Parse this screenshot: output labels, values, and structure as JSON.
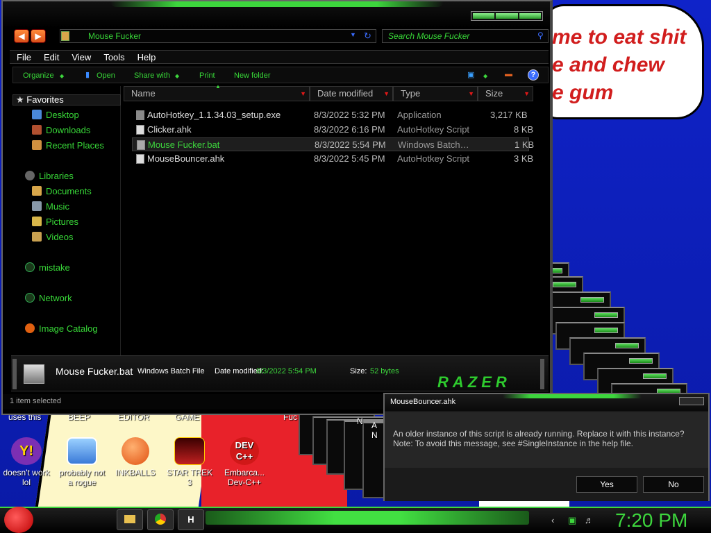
{
  "explorer": {
    "address": "Mouse Fucker",
    "search_placeholder": "Search Mouse Fucker",
    "menu": [
      "File",
      "Edit",
      "View",
      "Tools",
      "Help"
    ],
    "commands": [
      "Organize",
      "Open",
      "Share with",
      "Print",
      "New folder"
    ],
    "sidebar": {
      "favorites": "Favorites",
      "fav_items": [
        "Desktop",
        "Downloads",
        "Recent Places"
      ],
      "libraries": "Libraries",
      "lib_items": [
        "Documents",
        "Music",
        "Pictures",
        "Videos"
      ],
      "mistake": "mistake",
      "network": "Network",
      "catalog": "Image Catalog"
    },
    "columns": [
      "Name",
      "Date modified",
      "Type",
      "Size"
    ],
    "files": [
      {
        "name": "AutoHotkey_1.1.34.03_setup.exe",
        "date": "8/3/2022 5:32 PM",
        "type": "Application",
        "size": "3,217 KB"
      },
      {
        "name": "Clicker.ahk",
        "date": "8/3/2022 6:16 PM",
        "type": "AutoHotkey Script",
        "size": "8 KB"
      },
      {
        "name": "Mouse Fucker.bat",
        "date": "8/3/2022 5:54 PM",
        "type": "Windows Batch…",
        "size": "1 KB"
      },
      {
        "name": "MouseBouncer.ahk",
        "date": "8/3/2022 5:45 PM",
        "type": "AutoHotkey Script",
        "size": "3 KB"
      }
    ],
    "details": {
      "filename": "Mouse Fucker.bat",
      "filetype": "Windows Batch File",
      "date_label": "Date modified:",
      "date": "8/3/2022 5:54 PM",
      "size_label": "Size:",
      "size": "52 bytes",
      "brand": "RAZER"
    },
    "status": "1 item selected"
  },
  "dialog": {
    "title": "MouseBouncer.ahk",
    "line1": "An older instance of this script is already running.  Replace it with this instance?",
    "line2": "Note: To avoid this message, see #SingleInstance in the help file.",
    "yes": "Yes",
    "no": "No"
  },
  "wallpaper_bubble": [
    "me to eat shit",
    "e and chew",
    "e gum"
  ],
  "desktop": {
    "top_labels": [
      "uses this",
      "BEEP",
      "EDITOR",
      "GAME",
      "Fuc",
      "N",
      "A",
      "N"
    ],
    "icons": [
      {
        "label": "doesn't work lol"
      },
      {
        "label": "probably not a rogue"
      },
      {
        "label": "INKBALLS"
      },
      {
        "label": "STAR TREK 3"
      },
      {
        "label": "Embarca... Dev-C++"
      }
    ],
    "icon_texts": {
      "yahoo": "Y!",
      "dev": "DEV C++"
    }
  },
  "taskbar": {
    "clock": "7:20 PM",
    "pinned": [
      "folder",
      "chrome",
      "H"
    ]
  },
  "colors": {
    "accent": "#3dd63d",
    "text_green": "#38d838",
    "arrow_red": "#e01818"
  }
}
